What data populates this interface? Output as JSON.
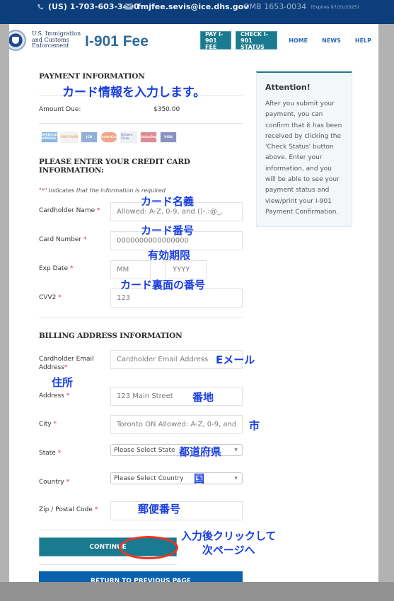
{
  "topbar": {
    "phone": "(US) 1-703-603-3400",
    "email": "fmjfee.sevis@ice.dhs.gov",
    "omb": "OMB 1653-0034",
    "omb_expires": "(Expires 07/31/2025)"
  },
  "header": {
    "agency_line1": "U.S. Immigration",
    "agency_line2": "and Customs",
    "agency_line3": "Enforcement",
    "title": "I-901 Fee",
    "nav_buttons": [
      "PAY I-901 FEE",
      "CHECK I-901 STATUS"
    ],
    "nav_links": [
      "HOME",
      "NEWS",
      "HELP"
    ]
  },
  "payment": {
    "heading": "PAYMENT INFORMATION",
    "amount_label": "Amount Due:",
    "amount_value": "$350.00",
    "cards": [
      {
        "name": "AMERICAN EXPRESS",
        "color": "#2a7bd0"
      },
      {
        "name": "DISCOVER",
        "color": "#e8e8e8"
      },
      {
        "name": "JCB",
        "color": "#3a6fb5"
      },
      {
        "name": "MasterCard",
        "color": "#e85c2c"
      },
      {
        "name": "Diners Club",
        "color": "#dfe6f2"
      },
      {
        "name": "UnionPay",
        "color": "#c82d3a"
      },
      {
        "name": "VISA",
        "color": "#2a3b8f"
      }
    ]
  },
  "credit_card": {
    "heading_line1": "PLEASE ENTER YOUR CREDIT CARD",
    "heading_line2": "INFORMATION:",
    "required_note_prefix": "\"",
    "required_note_star": "*",
    "required_note_suffix": "\" Indicates that the information is required",
    "cardholder_name_label": "Cardholder Name",
    "cardholder_name_placeholder": "Allowed: A-Z, 0-9, and ()-.:@_.",
    "card_number_label": "Card Number",
    "card_number_placeholder": "0000000000000000",
    "exp_date_label": "Exp Date",
    "exp_month_placeholder": "MM",
    "exp_year_placeholder": "YYYY",
    "cvv_label": "CVV2",
    "cvv_placeholder": "123",
    "required_star": "*"
  },
  "billing": {
    "heading": "BILLING ADDRESS INFORMATION",
    "email_label_line1": "Cardholder Email",
    "email_label_line2": "Address",
    "email_placeholder": "Cardholder Email Address",
    "address_label": "Address",
    "address_placeholder": "123 Main Street",
    "city_label": "City",
    "city_placeholder": "Toronto ON   Allowed: A-Z, 0-9, and",
    "state_label": "State",
    "state_selected": "Please Select State",
    "country_label": "Country",
    "country_selected": "Please Select Country",
    "zip_label": "Zip / Postal Code",
    "zip_value": ""
  },
  "actions": {
    "continue": "CONTINUE",
    "return": "RETURN TO PREVIOUS PAGE"
  },
  "attention": {
    "heading": "Attention!",
    "body": "After you submit your payment, you can confirm that it has been received by clicking the 'Check Status' button above. Enter your information, and you will be able to see your payment status and view/print your I-901 Payment Confirmation."
  },
  "annotations": {
    "card_info": "カード情報を入力します。",
    "card_name": "カード名義",
    "card_number": "カード番号",
    "expiry": "有効期限",
    "cvv": "カード裏面の番号",
    "email": "Eメール",
    "address": "住所",
    "street": "番地",
    "city": "市",
    "state": "都道府県",
    "country": "国",
    "zip": "郵便番号",
    "click_line1": "入力後クリックして",
    "click_line2": "次ページへ",
    "highlight_color": "#f0331f",
    "text_color": "#1a3fe0"
  }
}
